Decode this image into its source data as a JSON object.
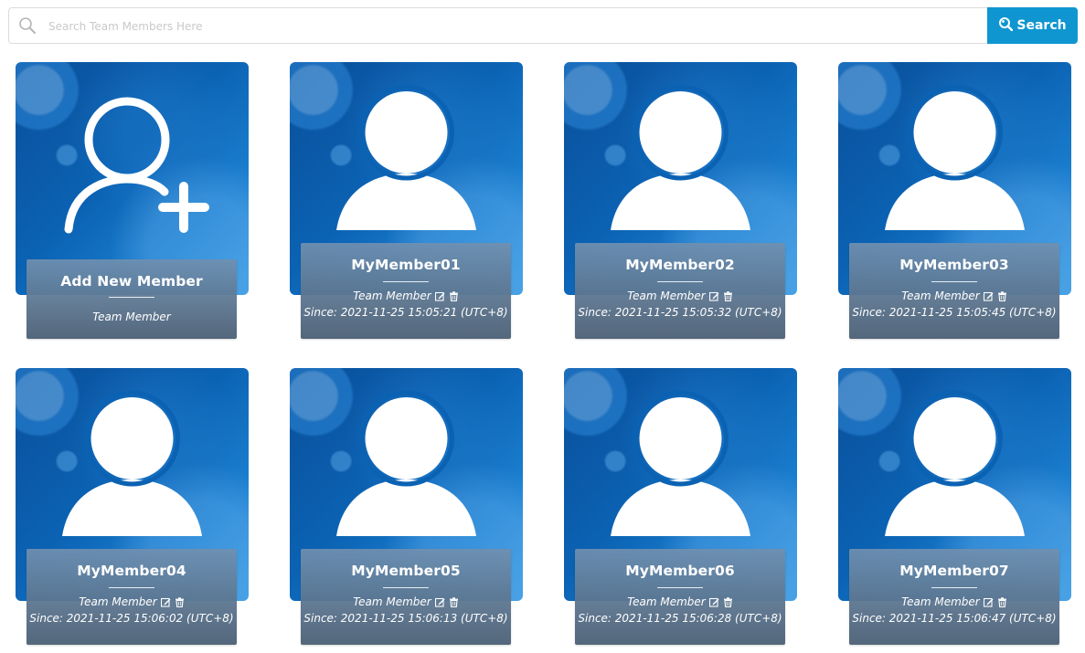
{
  "search": {
    "placeholder": "Search Team Members Here",
    "button_label": "Search"
  },
  "add_card": {
    "title": "Add New Member",
    "role": "Team Member"
  },
  "members": [
    {
      "name": "MyMember01",
      "role": "Team Member",
      "since": "Since: 2021-11-25 15:05:21 (UTC+8)"
    },
    {
      "name": "MyMember02",
      "role": "Team Member",
      "since": "Since: 2021-11-25 15:05:32 (UTC+8)"
    },
    {
      "name": "MyMember03",
      "role": "Team Member",
      "since": "Since: 2021-11-25 15:05:45 (UTC+8)"
    },
    {
      "name": "MyMember04",
      "role": "Team Member",
      "since": "Since: 2021-11-25 15:06:02 (UTC+8)"
    },
    {
      "name": "MyMember05",
      "role": "Team Member",
      "since": "Since: 2021-11-25 15:06:13 (UTC+8)"
    },
    {
      "name": "MyMember06",
      "role": "Team Member",
      "since": "Since: 2021-11-25 15:06:28 (UTC+8)"
    },
    {
      "name": "MyMember07",
      "role": "Team Member",
      "since": "Since: 2021-11-25 15:06:47 (UTC+8)"
    }
  ],
  "icons": {
    "search": "search-icon",
    "add_user": "add-user-icon",
    "user": "user-icon",
    "edit": "edit-icon",
    "delete": "trash-icon"
  },
  "colors": {
    "accent": "#0f96d0",
    "card_blue": "#0b62b3",
    "panel": "#6a88a6"
  }
}
